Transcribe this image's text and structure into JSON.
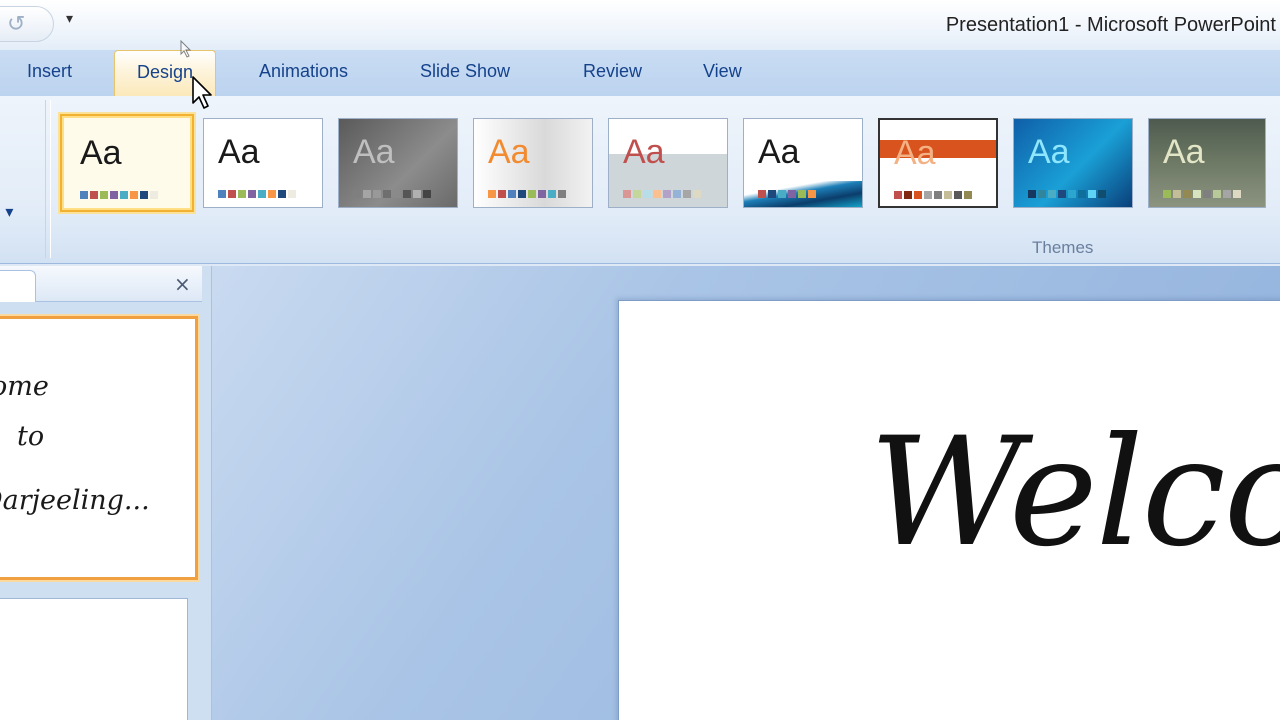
{
  "window": {
    "title": "Presentation1 - Microsoft PowerPoint",
    "qat_more": "▾",
    "undo_glyph": "↺"
  },
  "ribbon_tabs": [
    {
      "label": "Insert",
      "active": false
    },
    {
      "label": "Design",
      "active": true
    },
    {
      "label": "Animations",
      "active": false
    },
    {
      "label": "Slide Show",
      "active": false
    },
    {
      "label": "Review",
      "active": false
    },
    {
      "label": "View",
      "active": false
    }
  ],
  "ribbon": {
    "left_group_label": "n ▾",
    "themes_group_label": "Themes",
    "themes": [
      {
        "aa": "Aa",
        "style": "office",
        "selected": true
      },
      {
        "aa": "Aa",
        "style": "plain",
        "selected": false
      },
      {
        "aa": "Aa",
        "style": "dark-gray",
        "selected": false
      },
      {
        "aa": "Aa",
        "style": "orange-light",
        "selected": false
      },
      {
        "aa": "Aa",
        "style": "light-gray",
        "selected": false
      },
      {
        "aa": "Aa",
        "style": "blue-wave",
        "selected": false
      },
      {
        "aa": "Aa",
        "style": "orange-band",
        "selected": false
      },
      {
        "aa": "Aa",
        "style": "teal-blue",
        "selected": false
      },
      {
        "aa": "Aa",
        "style": "olive",
        "selected": false
      }
    ]
  },
  "slides_pane": {
    "close_glyph": "×",
    "thumb1_lines": [
      "ome",
      "to",
      "Darjeeling..."
    ]
  },
  "slide": {
    "title_text": "Welcome"
  },
  "colors": {
    "tab_text": "#15428b",
    "selected_border": "#f2b130",
    "thumb_selected_border": "#f0a040"
  }
}
